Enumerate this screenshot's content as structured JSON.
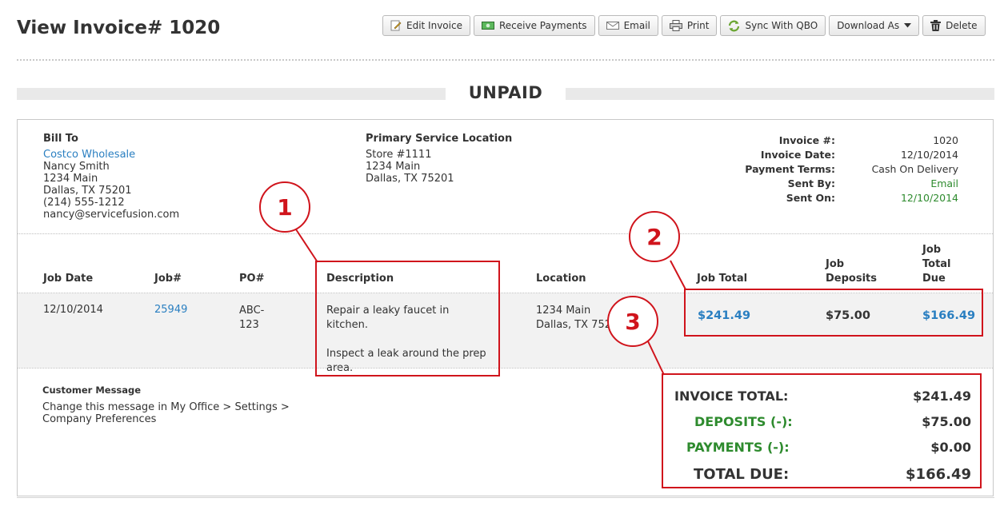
{
  "page": {
    "title": "View Invoice# 1020",
    "status": "UNPAID"
  },
  "toolbar": {
    "edit": "Edit Invoice",
    "receive": "Receive Payments",
    "email": "Email",
    "print": "Print",
    "sync": "Sync With QBO",
    "download": "Download As",
    "delete": "Delete"
  },
  "bill_to": {
    "heading": "Bill To",
    "company": "Costco Wholesale",
    "name": "Nancy Smith",
    "street": "1234 Main",
    "city": "Dallas, TX 75201",
    "phone": "(214) 555-1212",
    "email": "nancy@servicefusion.com"
  },
  "service_location": {
    "heading": "Primary Service Location",
    "name": "Store #1111",
    "street": "1234 Main",
    "city": "Dallas, TX 75201"
  },
  "invoice_meta": [
    {
      "label": "Invoice #:",
      "value": "1020"
    },
    {
      "label": "Invoice Date:",
      "value": "12/10/2014"
    },
    {
      "label": "Payment Terms:",
      "value": "Cash On Delivery"
    },
    {
      "label": "Sent By:",
      "value": "Email"
    },
    {
      "label": "Sent On:",
      "value": "12/10/2014"
    }
  ],
  "table": {
    "headers": {
      "job_date": "Job Date",
      "job_no": "Job#",
      "po": "PO#",
      "description": "Description",
      "location": "Location",
      "job_total": "Job Total",
      "job_deposits": "Job\nDeposits",
      "job_total_due": "Job\nTotal\nDue"
    },
    "row": {
      "job_date": "12/10/2014",
      "job_no": "25949",
      "po": "ABC-\n123",
      "description_1": "Repair a leaky faucet in kitchen.",
      "description_2": "Inspect a leak around the prep area.",
      "location": "1234 Main\nDallas, TX 75201",
      "job_total": "$241.49",
      "job_deposits": "$75.00",
      "job_total_due": "$166.49"
    }
  },
  "customer_message": {
    "heading": "Customer Message",
    "text": "Change this message in My Office > Settings > Company Preferences"
  },
  "totals": [
    {
      "label": "INVOICE TOTAL:",
      "value": "$241.49"
    },
    {
      "label": "DEPOSITS (-):",
      "value": "$75.00"
    },
    {
      "label": "PAYMENTS (-):",
      "value": "$0.00"
    },
    {
      "label": "TOTAL DUE:",
      "value": "$166.49"
    }
  ],
  "callouts": [
    "1",
    "2",
    "3"
  ],
  "colors": {
    "link": "#2a7fc1",
    "green": "#2e8b2e",
    "callout_red": "#d0141c"
  }
}
